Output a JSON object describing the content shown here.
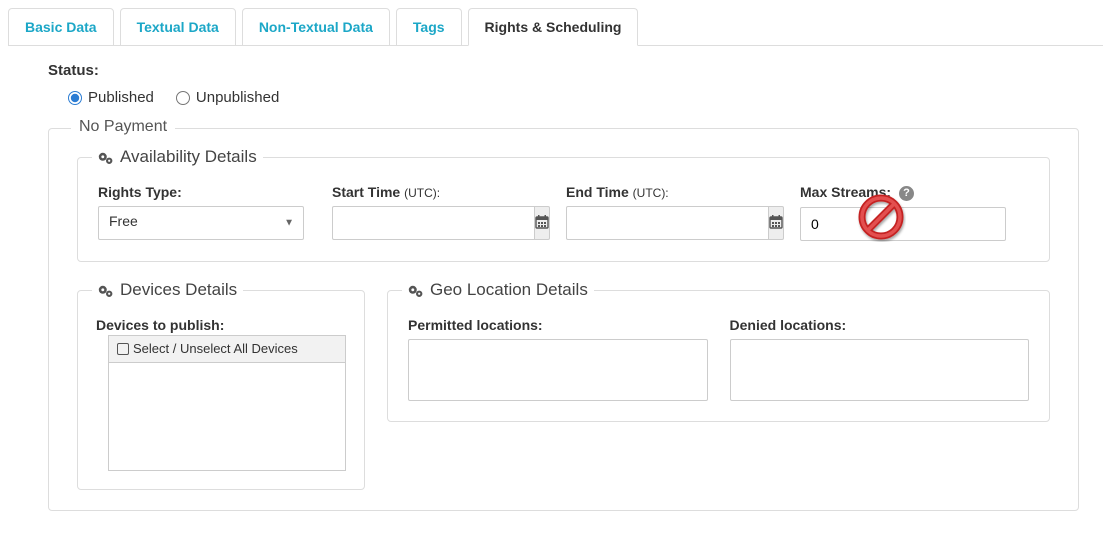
{
  "tabs": [
    {
      "label": "Basic Data"
    },
    {
      "label": "Textual Data"
    },
    {
      "label": "Non-Textual Data"
    },
    {
      "label": "Tags"
    },
    {
      "label": "Rights & Scheduling"
    }
  ],
  "status": {
    "label": "Status:",
    "published_label": "Published",
    "unpublished_label": "Unpublished",
    "selected": "Published"
  },
  "no_payment": {
    "legend": "No Payment",
    "availability": {
      "title": "Availability Details",
      "rights_type_label": "Rights Type:",
      "rights_type_value": "Free",
      "start_time_label": "Start Time",
      "start_time_sub": "(UTC):",
      "start_time_value": "",
      "end_time_label": "End Time",
      "end_time_sub": "(UTC):",
      "end_time_value": "",
      "max_streams_label": "Max Streams:",
      "max_streams_value": "0"
    },
    "devices": {
      "title": "Devices Details",
      "publish_label": "Devices to publish:",
      "select_all_label": "Select / Unselect All Devices"
    },
    "geo": {
      "title": "Geo Location Details",
      "permitted_label": "Permitted locations:",
      "denied_label": "Denied locations:"
    }
  },
  "annotation": {
    "type": "prohibition-icon",
    "color_outer": "#C42323",
    "color_inner": "#E35050"
  }
}
